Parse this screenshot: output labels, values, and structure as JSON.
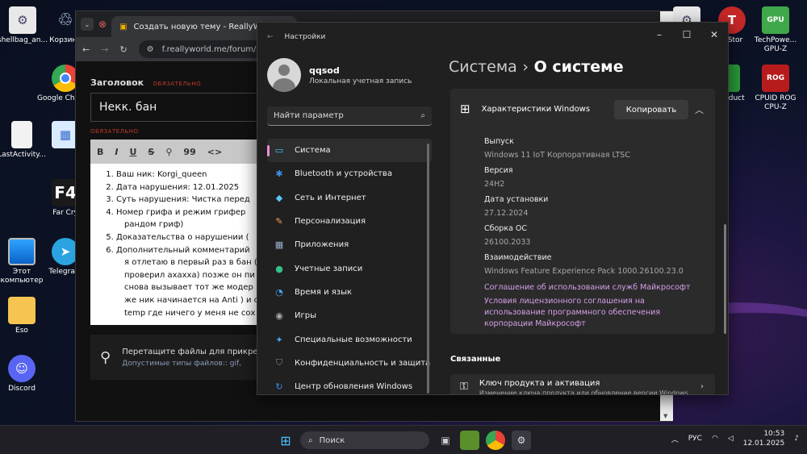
{
  "desktop": {
    "left_icons": [
      {
        "label": "shellbag_an...",
        "icon": "gear-file-icon"
      },
      {
        "label": "Корзина",
        "icon": "recycle-bin-icon"
      },
      {
        "label": "Google Chrome",
        "icon": "chrome-icon"
      },
      {
        "label": "LastActivity...",
        "icon": "document-icon"
      },
      {
        "label": "Far Cry",
        "icon": "farcry-icon"
      },
      {
        "label": "Этот компьютер",
        "icon": "monitor-icon"
      },
      {
        "label": "Telegram",
        "icon": "telegram-icon"
      },
      {
        "label": "Eso",
        "icon": "folder-icon"
      },
      {
        "label": "Discord",
        "icon": "discord-icon"
      }
    ],
    "right_icons": [
      {
        "label": "leStor",
        "icon": "tlauncher-icon"
      },
      {
        "label": "TechPowe... GPU-Z",
        "icon": "gpuz-icon"
      },
      {
        "label": "Reduct",
        "icon": "green-app-icon"
      },
      {
        "label": "CPUID ROG CPU-Z",
        "icon": "cpuz-icon"
      }
    ]
  },
  "browser": {
    "tab_title": "Создать новую тему - ReallyW",
    "url": "f.reallyworld.me/forum/1",
    "form": {
      "title_label": "Заголовок",
      "required_badge": "ОБЯЗАТЕЛЬНО",
      "title_value": "Некк. бан",
      "editor_required": "ОБЯЗАТЕЛЬНО",
      "toolbar": [
        "B",
        "I",
        "U",
        "S",
        "⚲",
        "99",
        "<>"
      ],
      "lines": [
        "Ваш ник: Korgi_queen",
        "Дата нарушения: 12.01.2025",
        "Суть нарушения: Чистка перед",
        "Номер грифа и режим грифер",
        "рандом гриф)",
        "Доказательства о нарушении (",
        "Дополнительный комментарий",
        "я отлетаю в первый раз в бан (",
        "проверил ахахха) позже он пи",
        "снова вызывает тот же модер",
        "же ник начинается на Anti ) и с",
        "temp где ничего у меня не сох"
      ],
      "attach_text": "Перетащите файлы для прикре",
      "allowed_types": "Допустимые типы файлов:: gif,"
    }
  },
  "settings": {
    "window_title": "Настройки",
    "user_name": "qqsod",
    "account_type": "Локальная учетная запись",
    "search_placeholder": "Найти параметр",
    "nav": [
      {
        "label": "Система",
        "icon": "monitor-icon",
        "color": "#4cc2ff",
        "glyph": "▭"
      },
      {
        "label": "Bluetooth и устройства",
        "icon": "bluetooth-icon",
        "color": "#3f8fe8",
        "glyph": "✱"
      },
      {
        "label": "Сеть и Интернет",
        "icon": "wifi-icon",
        "color": "#5ac8fa",
        "glyph": "◆"
      },
      {
        "label": "Персонализация",
        "icon": "brush-icon",
        "color": "#f0a050",
        "glyph": "✎"
      },
      {
        "label": "Приложения",
        "icon": "apps-icon",
        "color": "#9bb0d0",
        "glyph": "▦"
      },
      {
        "label": "Учетные записи",
        "icon": "person-icon",
        "color": "#35c08a",
        "glyph": "●"
      },
      {
        "label": "Время и язык",
        "icon": "globe-clock-icon",
        "color": "#4aa8f0",
        "glyph": "◔"
      },
      {
        "label": "Игры",
        "icon": "gamepad-icon",
        "color": "#aaaaaa",
        "glyph": "◉"
      },
      {
        "label": "Специальные возможности",
        "icon": "accessibility-icon",
        "color": "#4aa8f0",
        "glyph": "✦"
      },
      {
        "label": "Конфиденциальность и защита",
        "icon": "shield-icon",
        "color": "#8a8a8a",
        "glyph": "⛉"
      },
      {
        "label": "Центр обновления Windows",
        "icon": "update-icon",
        "color": "#3f8fe8",
        "glyph": "↻"
      }
    ],
    "breadcrumb_parent": "Система",
    "breadcrumb_sep": "›",
    "breadcrumb_current": "О системе",
    "specs_title": "Характеристики Windows",
    "copy_label": "Копировать",
    "specs": [
      {
        "key": "Выпуск",
        "value": "Windows 11 IoT Корпоративная LTSC"
      },
      {
        "key": "Версия",
        "value": "24H2"
      },
      {
        "key": "Дата установки",
        "value": "27.12.2024"
      },
      {
        "key": "Сборка ОС",
        "value": "26100.2033"
      },
      {
        "key": "Взаимодействие",
        "value": "Windows Feature Experience Pack 1000.26100.23.0"
      }
    ],
    "link1": "Соглашение об использовании служб Майкрософт",
    "link2": "Условия лицензионного соглашения на использование программного обеспечения корпорации Майкрософт",
    "related_title": "Связанные",
    "product_key": "Ключ продукта и активация",
    "product_key_sub": "Изменение ключа продукта или обновление версии Windows"
  },
  "taskbar": {
    "search": "Поиск",
    "lang": "РУС",
    "time": "10:53",
    "date": "12.01.2025"
  }
}
